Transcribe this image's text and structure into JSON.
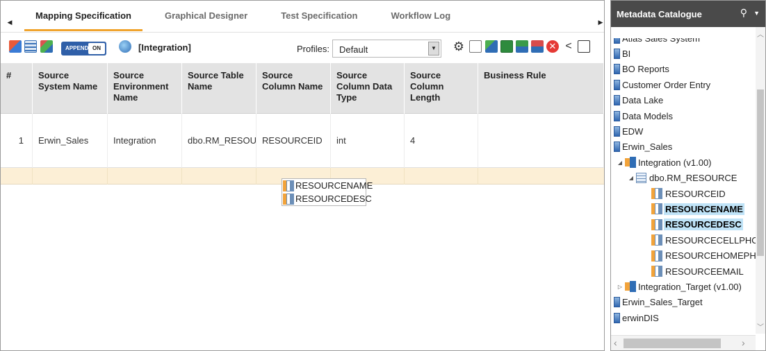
{
  "tabs": {
    "items": [
      "Mapping Specification",
      "Graphical Designer",
      "Test Specification",
      "Workflow Log"
    ],
    "active_index": 0
  },
  "toolbar": {
    "append_label": "APPEND",
    "append_state": "ON",
    "context_label": "[Integration]",
    "profiles_label": "Profiles:",
    "profile_value": "Default"
  },
  "grid": {
    "headers": [
      "#",
      "Source System Name",
      "Source Environment Name",
      "Source Table Name",
      "Source Column Name",
      "Source Column Data Type",
      "Source Column Length",
      "Business Rule"
    ],
    "rows": [
      [
        "1",
        "Erwin_Sales",
        "Integration",
        "dbo.RM_RESOURC",
        "RESOURCEID",
        "int",
        "4",
        ""
      ]
    ]
  },
  "drag_ghost": [
    "RESOURCENAME",
    "RESOURCEDESC"
  ],
  "catalog": {
    "title": "Metadata Catalogue",
    "items": [
      {
        "label": "Atlas Sales System",
        "type": "system"
      },
      {
        "label": "BI",
        "type": "system"
      },
      {
        "label": "BO Reports",
        "type": "system"
      },
      {
        "label": "Customer Order Entry",
        "type": "system"
      },
      {
        "label": "Data Lake",
        "type": "system"
      },
      {
        "label": "Data Models",
        "type": "system"
      },
      {
        "label": "EDW",
        "type": "system"
      },
      {
        "label": "Erwin_Sales",
        "type": "system"
      },
      {
        "label": "Integration (v1.00)",
        "type": "environment",
        "expanded": true
      },
      {
        "label": "dbo.RM_RESOURCE",
        "type": "table",
        "expanded": true
      },
      {
        "label": "RESOURCEID",
        "type": "column"
      },
      {
        "label": "RESOURCENAME",
        "type": "column",
        "selected": true
      },
      {
        "label": "RESOURCEDESC",
        "type": "column",
        "selected": true
      },
      {
        "label": "RESOURCECELLPHONE",
        "type": "column"
      },
      {
        "label": "RESOURCEHOMEPHONI",
        "type": "column"
      },
      {
        "label": "RESOURCEEMAIL",
        "type": "column"
      },
      {
        "label": "Integration_Target (v1.00)",
        "type": "environment",
        "expanded": false
      },
      {
        "label": "Erwin_Sales_Target",
        "type": "system"
      },
      {
        "label": "erwinDIS",
        "type": "system"
      }
    ]
  },
  "colors": {
    "tab_underline": "#f0a32c",
    "header_bg": "#e3e3e3",
    "drop_row_bg": "#fcefd6",
    "catalog_header_bg": "#4a4a4a",
    "selection_bg": "#bfe3f7",
    "append_bg": "#2f5fa8"
  }
}
